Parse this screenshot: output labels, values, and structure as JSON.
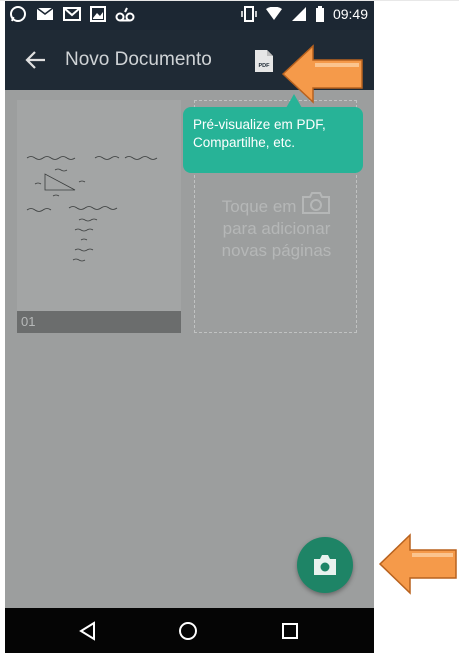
{
  "status_bar": {
    "time": "09:49",
    "left_icons": [
      "whatsapp-icon",
      "message-icon",
      "gmail-icon",
      "gallery-icon",
      "voicemail-icon"
    ],
    "right_icons": [
      "vibrate-icon",
      "wifi-icon",
      "signal-icon",
      "battery-icon"
    ]
  },
  "app_bar": {
    "title": "Novo Documento",
    "pdf_label": "PDF"
  },
  "pages": [
    {
      "number": "01"
    }
  ],
  "add_page": {
    "line1": "Toque em",
    "line2": "para adicionar",
    "line3": "novas páginas"
  },
  "tooltip": {
    "text_line1": "Pré-visualize em PDF,",
    "text_line2": "Compartilhe, etc."
  },
  "colors": {
    "app_bar": "#1f2a35",
    "accent": "#27b397",
    "fab": "#1e8466",
    "arrow": "#f59a4a"
  }
}
